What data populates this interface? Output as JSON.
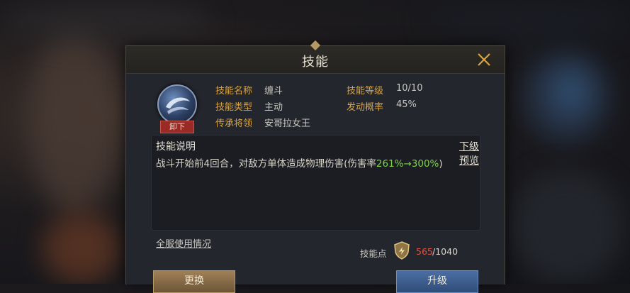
{
  "dialog": {
    "title": "技能",
    "close_icon": "close-icon"
  },
  "skill": {
    "icon": "crescent-wind-skill-icon",
    "unload_label": "卸下",
    "fields": [
      {
        "label": "技能名称",
        "value": "缠斗"
      },
      {
        "label": "技能类型",
        "value": "主动"
      },
      {
        "label": "传承将领",
        "value": "安哥拉女王"
      },
      {
        "label": "技能等级",
        "value": "10/10"
      },
      {
        "label": "发动概率",
        "value": "45%"
      }
    ]
  },
  "description": {
    "title": "技能说明",
    "preview_link": "下级预览",
    "text_prefix": "战斗开始前4回合，对敌方单体造成物理伤害(伤害率",
    "text_highlight": "261%→300%",
    "text_suffix": ")"
  },
  "footer": {
    "usage_link": "全服使用情况",
    "points_label": "技能点",
    "points_icon": "skill-point-shield-icon",
    "points_current": "565",
    "points_max": "/1040"
  },
  "buttons": {
    "replace_label": "更换",
    "upgrade_label": "升级"
  },
  "colors": {
    "label_gold": "#d9a442",
    "highlight_green": "#7ed348",
    "points_red": "#e0523f"
  }
}
